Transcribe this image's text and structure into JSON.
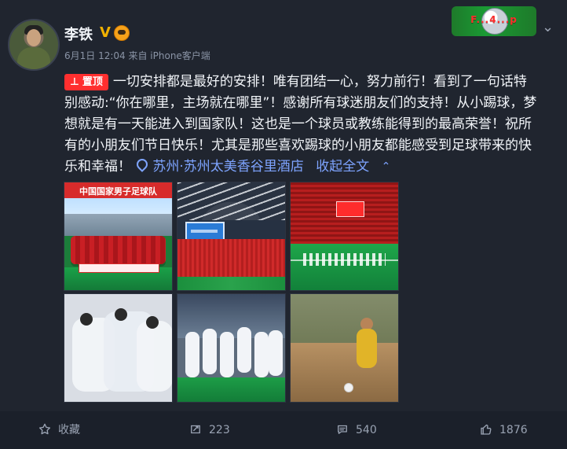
{
  "header": {
    "name": "李铁",
    "verified_badge": "V",
    "meta": "6月1日 12:04 来自 iPhone客户端",
    "banner_text": "F...4...p"
  },
  "post": {
    "pin_label": "置顶",
    "line1": "一切安排都是最好的安排！唯有团结一心，努力前行！看到了一句话特",
    "line2": "别感动:“你在哪里，主场就在哪里”！感谢所有球迷朋友们的支持！从小踢球，梦",
    "line3": "想就是有一天能进入到国家队！这也是一个球员或教练能得到的最高荣誉！祝所",
    "line4": "有的小朋友们节日快乐！尤其是那些喜欢踢球的小朋友都能感受到足球带来的快",
    "line5_prefix": "乐和幸福！",
    "location": "苏州·苏州太美香谷里酒店",
    "collapse": "收起全文"
  },
  "images": {
    "img1_caption": "中国国家男子足球队"
  },
  "actions": {
    "favorite": "收藏",
    "repost": "223",
    "comment": "540",
    "like": "1876"
  },
  "icons": {
    "star": "star-icon",
    "repost": "repost-icon",
    "comment": "comment-icon",
    "like": "like-icon",
    "more": "chevron-down-icon",
    "location": "location-pin-icon"
  },
  "colors": {
    "background": "#20252f",
    "text": "#f2f5f9",
    "meta": "#8a94a6",
    "link": "#7ea4ff",
    "pin": "#ff2f2f"
  }
}
